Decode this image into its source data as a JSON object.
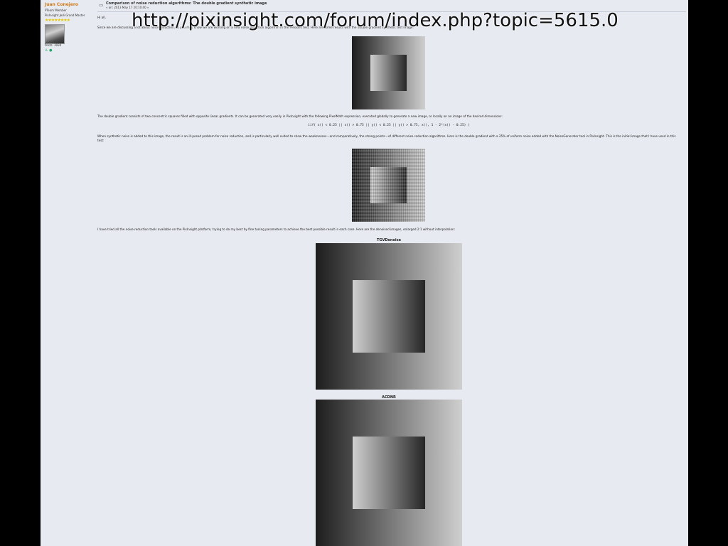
{
  "overlay": {
    "url": "http://pixinsight.com/forum/index.php?topic=5615.0"
  },
  "poster": {
    "name": "Juan Conejero",
    "rank": "PTeam Member",
    "group": "PixInsight Jedi Grand Master",
    "stars": "★★★★★★★★",
    "posts": "Posts: 3930",
    "icons": "♙ ●"
  },
  "post": {
    "title": "Comparison of noise reduction algorithms: The double gradient synthetic image",
    "date": "« on: 2013 May 17 20:10:40 »",
    "greeting": "Hi all,",
    "intro": "Since we are discussing a lot about noise reduction, as you may know we are working on a new noise reduction algorithm in the Pleiades test. Here are some results with the double gradient synthetic test image.",
    "p_gradient": "The double gradient consists of two concentric squares filled with opposite linear gradients. It can be generated very easily in PixInsight with the following PixelMath expression, executed globally to generate a new image, or locally on an image of the desired dimensions:",
    "code": "iif( x() < 0.25 || x() > 0.75 || y() < 0.25 || y() > 0.75, x(), 1 - 2*(x() - 0.25) )",
    "p_noise": "When synthetic noise is added to this image, the result is an ill-posed problem for noise reduction, and is particularly well suited to show the weaknesses---and comparatively, the strong points---of different noise reduction algorithms. Here is the double gradient with a 25% of uniform noise added with the NoiseGenerator tool in PixInsight. This is the initial image that I have used in this test:",
    "p_tools": "I have tried all the noise reduction tools available on the PixInsight platform, trying to do my best by fine tuning parameters to achieve the best possible result in each case. Here are the denoised images, enlarged 2:1 without interpolation:",
    "caption1": "TGVDenoise",
    "caption2": "ACDNR"
  }
}
